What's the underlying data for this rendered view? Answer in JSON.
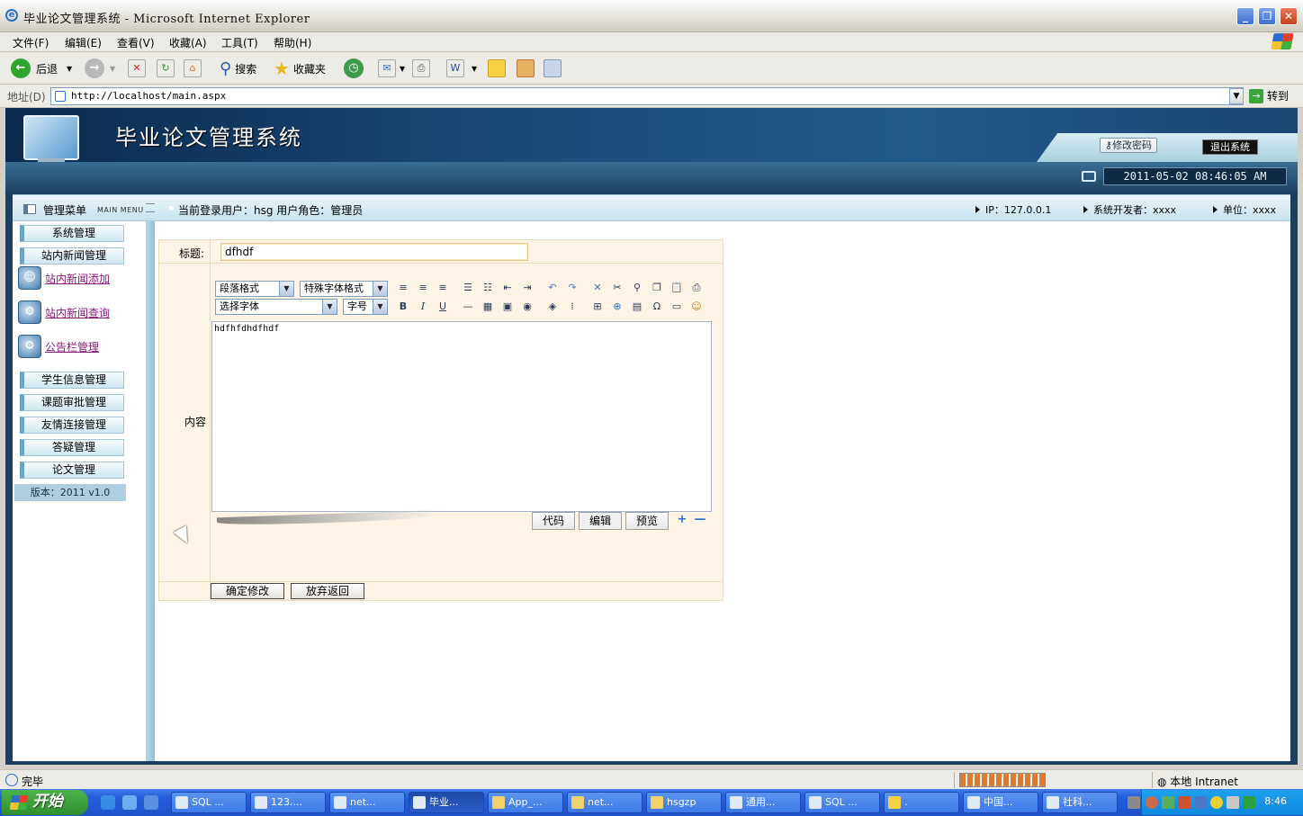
{
  "window": {
    "title": "毕业论文管理系统 - Microsoft Internet Explorer",
    "minimize": "_",
    "maximize": "❐",
    "close": "✕"
  },
  "menu": [
    "文件(F)",
    "编辑(E)",
    "查看(V)",
    "收藏(A)",
    "工具(T)",
    "帮助(H)"
  ],
  "toolbar": {
    "back": "后退",
    "search": "搜索",
    "favorites": "收藏夹"
  },
  "address": {
    "label": "地址(D)",
    "url": "http://localhost/main.aspx",
    "go": "转到"
  },
  "header": {
    "system_title": "毕业论文管理系统",
    "change_password": "修改密码",
    "logout": "退出系统",
    "datetime": "2011-05-02 08:46:05 AM"
  },
  "infobar": {
    "menu_title": "管理菜单",
    "menu_title_en": "MAIN MENU",
    "current_user": "当前登录用户：hsg  用户角色：管理员",
    "ip": "IP：127.0.0.1",
    "developer": "系统开发者：xxxx",
    "unit": "单位：xxxx"
  },
  "sidebar": {
    "top_items": [
      "系统管理",
      "站内新闻管理"
    ],
    "sub_items": [
      "站内新闻添加",
      "站内新闻查询",
      "公告栏管理"
    ],
    "bottom_items": [
      "学生信息管理",
      "课题审批管理",
      "友情连接管理",
      "答疑管理",
      "论文管理"
    ],
    "version": "版本：2011 v1.0"
  },
  "form": {
    "title_label": "标题:",
    "title_value": "dfhdf",
    "content_label": "内容",
    "content_value": "hdfhfdhdfhdf",
    "confirm_button": "确定修改",
    "cancel_button": "放弃返回"
  },
  "editor": {
    "paragraph_format": "段落格式",
    "special_format": "特殊字体格式",
    "font_select": "选择字体",
    "font_size": "字号",
    "bold": "B",
    "italic": "I",
    "underline": "U",
    "mode_code": "代码",
    "mode_edit": "编辑",
    "mode_preview": "预览",
    "plus": "+",
    "minus": "—"
  },
  "statusbar": {
    "status": "完毕",
    "zone": "本地 Intranet"
  },
  "taskbar": {
    "start": "开始",
    "tasks": [
      "SQL ...",
      "123....",
      "net...",
      "毕业...",
      "App_...",
      "net...",
      "hsgzp",
      "通用...",
      "SQL ...",
      ".",
      "中国...",
      "社科..."
    ],
    "time": "8:46"
  },
  "colors": {
    "banner": "#1b4a76",
    "frame": "#1c3f60",
    "form_bg": "#fdf4e6",
    "link": "#8a1a7a",
    "taskbar": "#245edb"
  }
}
